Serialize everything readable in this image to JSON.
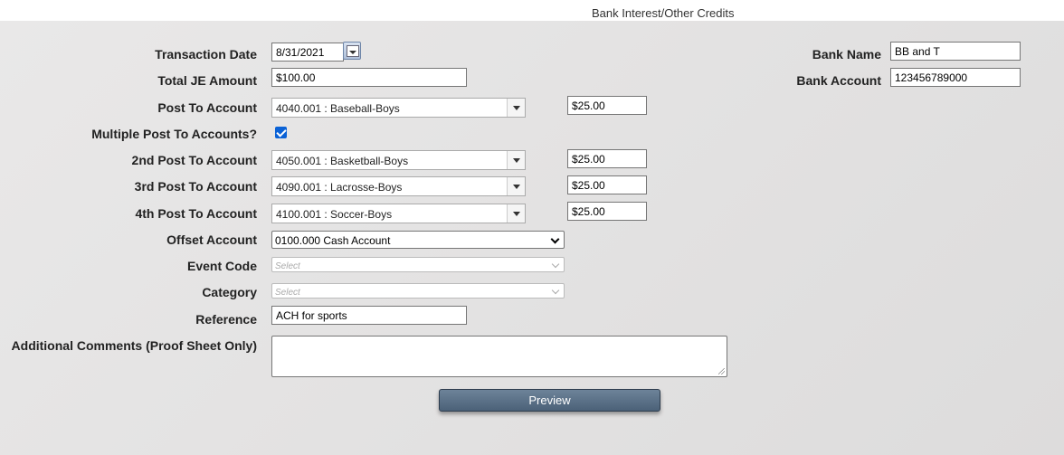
{
  "page": {
    "title": "Bank Interest/Other Credits"
  },
  "form": {
    "transaction_date": {
      "label": "Transaction Date",
      "value": "8/31/2021"
    },
    "total_je_amount": {
      "label": "Total JE Amount",
      "value": "$100.00"
    },
    "post_to_account": {
      "label": "Post To Account",
      "value": "4040.001 : Baseball-Boys",
      "amount": "$25.00"
    },
    "multiple_post": {
      "label": "Multiple Post To Accounts?",
      "checked": true
    },
    "post_2": {
      "label": "2nd Post To Account",
      "value": "4050.001 : Basketball-Boys",
      "amount": "$25.00"
    },
    "post_3": {
      "label": "3rd Post To Account",
      "value": "4090.001 : Lacrosse-Boys",
      "amount": "$25.00"
    },
    "post_4": {
      "label": "4th Post To Account",
      "value": "4100.001 : Soccer-Boys",
      "amount": "$25.00"
    },
    "offset_account": {
      "label": "Offset Account",
      "value": "0100.000 Cash Account"
    },
    "event_code": {
      "label": "Event Code",
      "placeholder": "Select"
    },
    "category": {
      "label": "Category",
      "placeholder": "Select"
    },
    "reference": {
      "label": "Reference",
      "value": "ACH for sports"
    },
    "comments": {
      "label": "Additional Comments (Proof Sheet Only)",
      "value": ""
    },
    "bank_name": {
      "label": "Bank Name",
      "value": "BB and T"
    },
    "bank_account": {
      "label": "Bank Account",
      "value": "123456789000"
    }
  },
  "actions": {
    "preview_label": "Preview"
  },
  "icons": {
    "calendar": "calendar-icon",
    "dropdown": "chevron-down-icon",
    "checkbox": "checkmark-icon"
  },
  "colors": {
    "button": "#5a7087",
    "checkbox": "#0b62d6",
    "panel": "#e3e2e2"
  }
}
